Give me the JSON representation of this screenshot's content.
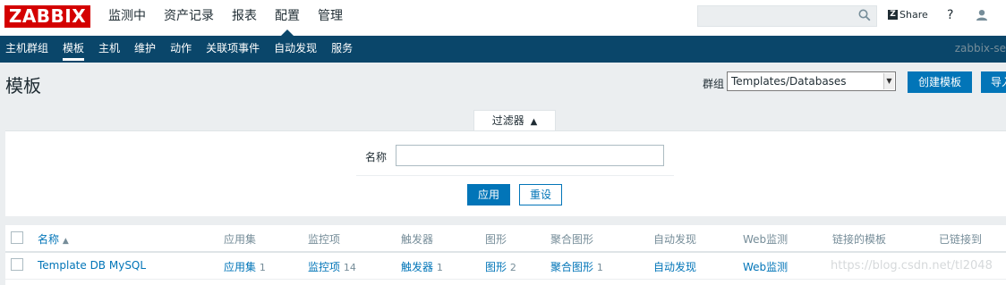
{
  "logo": "ZABBIX",
  "top_nav": [
    "监测中",
    "资产记录",
    "报表",
    "配置",
    "管理"
  ],
  "share_label": "Share",
  "help_label": "?",
  "sub_nav": [
    "主机群组",
    "模板",
    "主机",
    "维护",
    "动作",
    "关联项事件",
    "自动发现",
    "服务"
  ],
  "server_name": "zabbix-se",
  "page_title": "模板",
  "group_label": "群组",
  "group_value": "Templates/Databases",
  "create_button": "创建模板",
  "import_button": "导入",
  "filter_tab": "过滤器",
  "filter_name_label": "名称",
  "filter_name_value": "",
  "apply_button": "应用",
  "reset_button": "重设",
  "table": {
    "headers": [
      "名称",
      "应用集",
      "监控项",
      "触发器",
      "图形",
      "聚合图形",
      "自动发现",
      "Web监测",
      "链接的模板",
      "已链接到"
    ],
    "sort_indicator": "▲",
    "row": {
      "name": "Template DB MySQL",
      "applications": "应用集",
      "applications_count": "1",
      "items": "监控项",
      "items_count": "14",
      "triggers": "触发器",
      "triggers_count": "1",
      "graphs": "图形",
      "graphs_count": "2",
      "screens": "聚合图形",
      "screens_count": "1",
      "discovery": "自动发现",
      "web": "Web监测"
    }
  },
  "watermark": "https://blog.csdn.net/tl2048",
  "colors": {
    "brand_red": "#d40000",
    "nav_dark": "#0a466a",
    "button_blue": "#0275b8",
    "link_blue": "#0275b8",
    "background": "#ebeef0"
  },
  "icons": [
    "search-icon",
    "share-icon",
    "help-icon",
    "user-icon",
    "caret-up-icon",
    "dropdown-arrow-icon"
  ]
}
